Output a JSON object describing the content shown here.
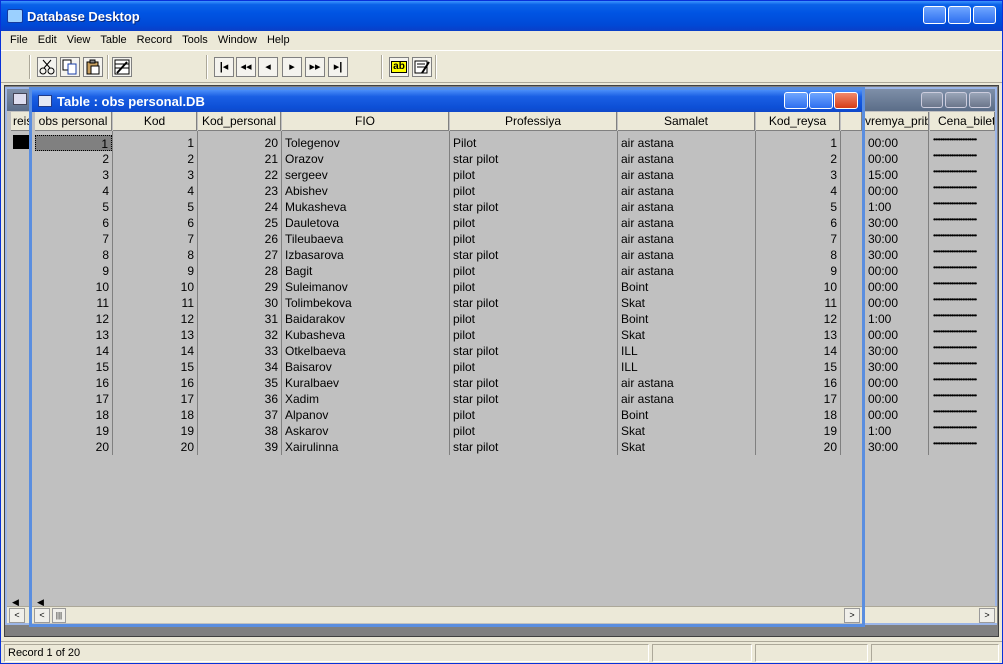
{
  "app": {
    "title": "Database Desktop"
  },
  "menu": [
    "File",
    "Edit",
    "View",
    "Table",
    "Record",
    "Tools",
    "Window",
    "Help"
  ],
  "toolbar": {
    "cut": "cut-icon",
    "copy": "copy-icon",
    "paste": "paste-icon",
    "restructure": "restructure-icon",
    "nav_first": "first-record-icon",
    "nav_prev_set": "previous-set-icon",
    "nav_prev": "previous-record-icon",
    "nav_next": "next-record-icon",
    "nav_next_set": "next-set-icon",
    "nav_last": "last-record-icon",
    "field_view_label": "ab"
  },
  "bg_table": {
    "headers": {
      "left_col": "reis",
      "vremya_prib": "vremya_prib",
      "cena_bileta": "Cena_bileta"
    },
    "vremya_cells": [
      "00:00",
      "00:00",
      "15:00",
      "00:00",
      "1:00",
      "30:00",
      "30:00",
      "30:00",
      "00:00",
      "00:00",
      "00:00",
      "1:00",
      "00:00",
      "30:00",
      "30:00",
      "00:00",
      "00:00",
      "00:00",
      "1:00",
      "30:00"
    ],
    "cena_cells": "••••••••••••••••••••••••"
  },
  "table": {
    "title": "Table : obs personal.DB",
    "headers": [
      "obs personal",
      "Kod",
      "Kod_personal",
      "FIO",
      "Professiya",
      "Samalet",
      "Kod_reysa"
    ],
    "rows": [
      [
        "1",
        "1",
        "20",
        "Tolegenov",
        "Pilot",
        "air astana",
        "1"
      ],
      [
        "2",
        "2",
        "21",
        "Orazov",
        "star pilot",
        "air astana",
        "2"
      ],
      [
        "3",
        "3",
        "22",
        "sergeev",
        "pilot",
        "air astana",
        "3"
      ],
      [
        "4",
        "4",
        "23",
        "Abishev",
        "pilot",
        "air astana",
        "4"
      ],
      [
        "5",
        "5",
        "24",
        "Mukasheva",
        "star pilot",
        "air astana",
        "5"
      ],
      [
        "6",
        "6",
        "25",
        "Dauletova",
        "pilot",
        "air astana",
        "6"
      ],
      [
        "7",
        "7",
        "26",
        "Tileubaeva",
        "pilot",
        "air astana",
        "7"
      ],
      [
        "8",
        "8",
        "27",
        "Izbasarova",
        "star pilot",
        "air astana",
        "8"
      ],
      [
        "9",
        "9",
        "28",
        "Bagit",
        "pilot",
        "air astana",
        "9"
      ],
      [
        "10",
        "10",
        "29",
        "Suleimanov",
        "pilot",
        "Boint",
        "10"
      ],
      [
        "11",
        "11",
        "30",
        "Tolimbekova",
        "star pilot",
        "Skat",
        "11"
      ],
      [
        "12",
        "12",
        "31",
        "Baidarakov",
        "pilot",
        "Boint",
        "12"
      ],
      [
        "13",
        "13",
        "32",
        "Kubasheva",
        "pilot",
        "Skat",
        "13"
      ],
      [
        "14",
        "14",
        "33",
        "Otkelbaeva",
        "star pilot",
        "ILL",
        "14"
      ],
      [
        "15",
        "15",
        "34",
        "Baisarov",
        "pilot",
        "ILL",
        "15"
      ],
      [
        "16",
        "16",
        "35",
        "Kuralbaev",
        "star pilot",
        "air astana",
        "16"
      ],
      [
        "17",
        "17",
        "36",
        "Xadim",
        "star pilot",
        "air astana",
        "17"
      ],
      [
        "18",
        "18",
        "37",
        "Alpanov",
        "pilot",
        "Boint",
        "18"
      ],
      [
        "19",
        "19",
        "38",
        "Askarov",
        "pilot",
        "Skat",
        "19"
      ],
      [
        "20",
        "20",
        "39",
        "Xairulinna",
        "star pilot",
        "Skat",
        "20"
      ]
    ]
  },
  "status": {
    "record": "Record 1 of 20"
  }
}
